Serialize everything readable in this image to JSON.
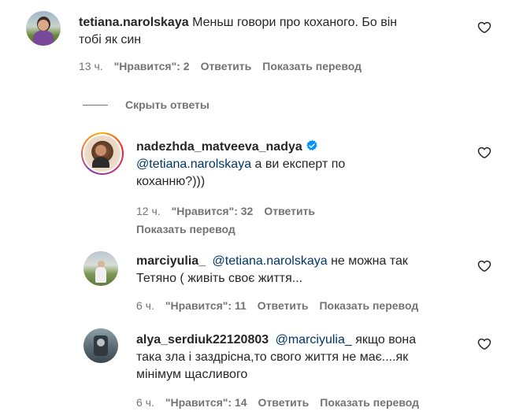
{
  "comments": [
    {
      "username": "tetiana.narolskaya",
      "text": "Меньш говори про коханого. Бо він тобі як син",
      "line1": "Меньш говори про коханого. Бо він",
      "line2": "тобі як син",
      "time": "13 ч.",
      "likes": "\"Нравится\": 2",
      "reply": "Ответить",
      "translate": "Показать перевод"
    },
    {
      "username": "nadezhda_matveeva_nadya",
      "mention": "@tetiana.narolskaya",
      "line1": " а ви експерт по",
      "line2": "коханню?)))",
      "time": "12 ч.",
      "likes": "\"Нравится\": 32",
      "reply": "Ответить",
      "translate": "Показать перевод"
    },
    {
      "username": "marciyulia_",
      "mention": "@tetiana.narolskaya",
      "line1": " не можна так",
      "line2": "Тетяно ( живіть своє життя...",
      "time": "6 ч.",
      "likes": "\"Нравится\": 11",
      "reply": "Ответить",
      "translate": "Показать перевод"
    },
    {
      "username": "alya_serdiuk22120803",
      "mention": "@marciyulia_",
      "line1": " якщо вона",
      "line2": "така зла і заздрісна,то свого життя не має....як",
      "line3": "мінімум щасливого",
      "time": "6 ч.",
      "likes": "\"Нравится\": 14",
      "reply": "Ответить",
      "translate": "Показать перевод"
    }
  ],
  "hide_replies": "Скрыть ответы",
  "icons": {
    "heart": "heart-icon",
    "verified": "verified-badge-icon"
  },
  "colors": {
    "text": "#262626",
    "secondary": "#737373",
    "mention": "#00376b",
    "verified": "#0095f6"
  }
}
